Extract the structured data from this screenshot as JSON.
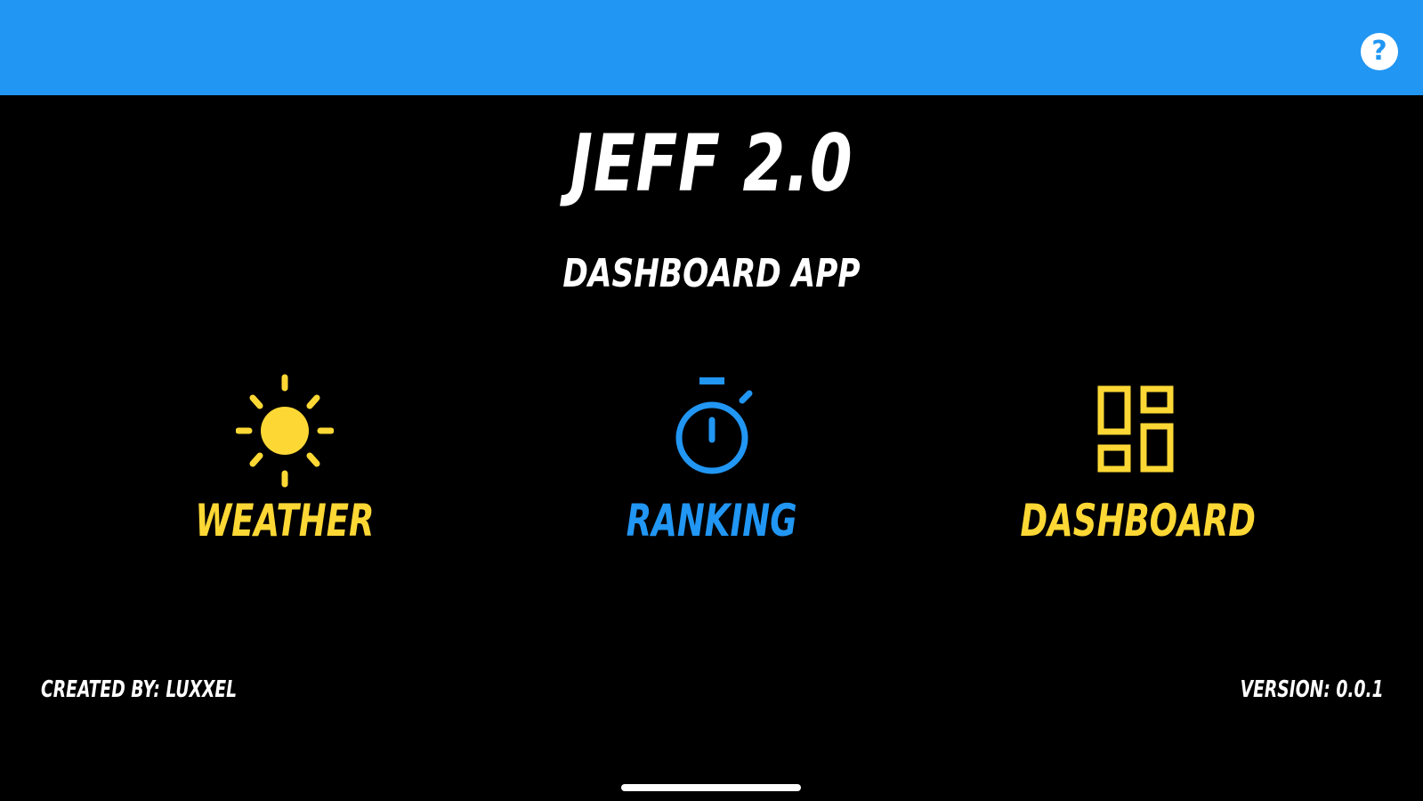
{
  "header": {
    "help_icon": "question-mark-circle-icon",
    "help_glyph": "?",
    "bar_color": "#2196F3"
  },
  "app": {
    "title": "JEFF 2.0",
    "subtitle": "DASHBOARD APP"
  },
  "menu": [
    {
      "label": "WEATHER",
      "icon": "sun-icon",
      "color": "#FDD835"
    },
    {
      "label": "RANKING",
      "icon": "stopwatch-icon",
      "color": "#2196F3"
    },
    {
      "label": "DASHBOARD",
      "icon": "dashboard-grid-icon",
      "color": "#FDD835"
    }
  ],
  "footer": {
    "created_by": "CREATED BY: LUXXEL",
    "version": "VERSION: 0.0.1"
  }
}
